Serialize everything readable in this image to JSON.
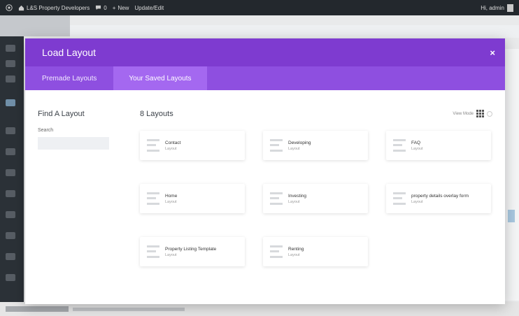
{
  "admin_bar": {
    "site_name": "L&S Property Developers",
    "comments_count": "0",
    "new_label": "New",
    "update_label": "Update/Edit",
    "user_greeting": "Hi, admin"
  },
  "modal": {
    "title": "Load Layout",
    "close_glyph": "×",
    "tabs": [
      {
        "label": "Premade Layouts",
        "active": false
      },
      {
        "label": "Your Saved Layouts",
        "active": true
      }
    ],
    "sidebar": {
      "title": "Find A Layout",
      "search_label": "Search",
      "search_value": ""
    },
    "main": {
      "count_label": "8 Layouts",
      "view_mode_label": "View Mode"
    },
    "layouts": [
      {
        "name": "Contact",
        "type": "Layout"
      },
      {
        "name": "Developing",
        "type": "Layout"
      },
      {
        "name": "FAQ",
        "type": "Layout"
      },
      {
        "name": "Home",
        "type": "Layout"
      },
      {
        "name": "Investing",
        "type": "Layout"
      },
      {
        "name": "property details overlay form",
        "type": "Layout"
      },
      {
        "name": "Property Listing Template",
        "type": "Layout"
      },
      {
        "name": "Renting",
        "type": "Layout"
      }
    ]
  },
  "colors": {
    "header": "#7e3bd0",
    "tab_bar": "#8e4fe0",
    "tab_active": "#a468f0",
    "admin_bar": "#23282d"
  },
  "icons": [
    "wordpress-icon",
    "home-icon",
    "comment-icon",
    "plus-icon",
    "close-icon",
    "grid-view-icon",
    "list-view-icon",
    "layout-thumbnail-icon"
  ]
}
